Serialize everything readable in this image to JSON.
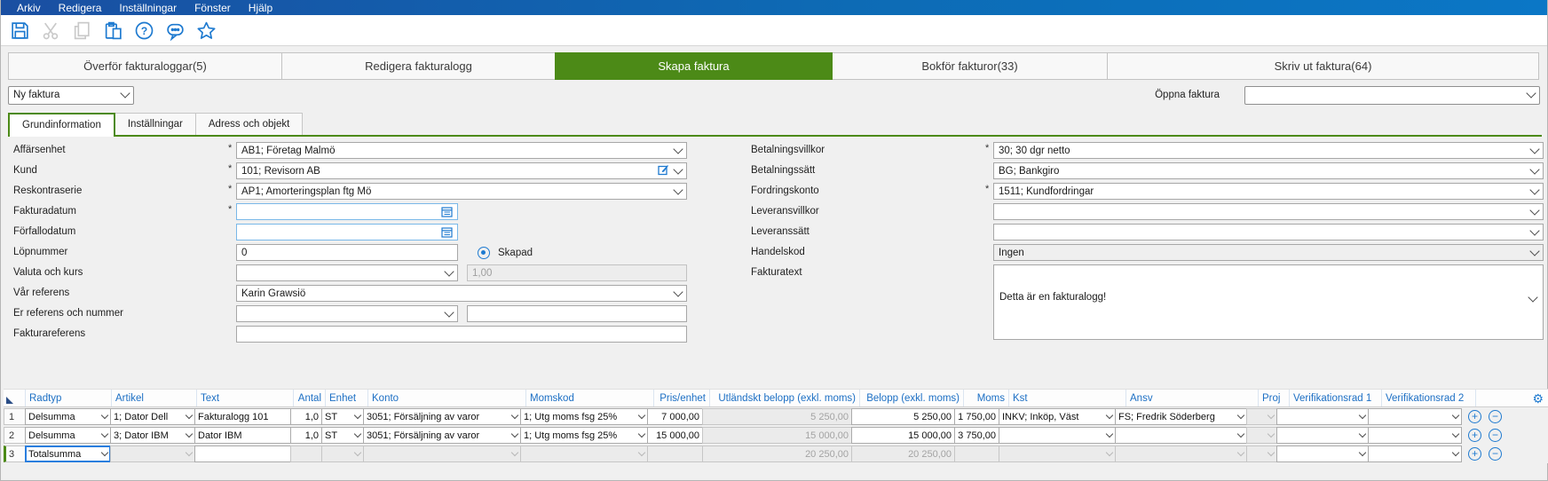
{
  "ui": {
    "required_marker": "*"
  },
  "colors": {
    "accent_green": "#4c8a17",
    "accent_blue": "#1e7ad0",
    "grid_header_text": "#1c6fc4",
    "menubar_left": "#1a4fa2",
    "menubar_right": "#0b77c6"
  },
  "menu": {
    "items": [
      "Arkiv",
      "Redigera",
      "Inställningar",
      "Fönster",
      "Hjälp"
    ]
  },
  "toolbar": {
    "icons": [
      "save-icon",
      "cut-icon",
      "copy-icon",
      "paste-icon",
      "help-icon",
      "comment-icon",
      "favorite-star-icon"
    ]
  },
  "main_tabs": [
    {
      "label": "Överför fakturaloggar(5)",
      "active": false
    },
    {
      "label": "Redigera fakturalogg",
      "active": false
    },
    {
      "label": "Skapa faktura",
      "active": true
    },
    {
      "label": "Bokför fakturor(33)",
      "active": false
    },
    {
      "label": "Skriv ut faktura(64)",
      "active": false
    }
  ],
  "invoice_bar": {
    "new_invoice_value": "Ny faktura",
    "open_invoice_label": "Öppna faktura",
    "open_invoice_value": ""
  },
  "sub_tabs": [
    {
      "label": "Grundinformation",
      "active": true
    },
    {
      "label": "Inställningar",
      "active": false
    },
    {
      "label": "Adress och objekt",
      "active": false
    }
  ],
  "form": {
    "affarsenhet": {
      "label": "Affärsenhet",
      "value": "AB1; Företag Malmö",
      "required": true
    },
    "kund": {
      "label": "Kund",
      "value": "101; Revisorn AB",
      "required": true
    },
    "reskontraserie": {
      "label": "Reskontraserie",
      "value": "AP1; Amorteringsplan ftg Mö",
      "required": true
    },
    "fakturadatum": {
      "label": "Fakturadatum",
      "value": "",
      "required": true
    },
    "forfallodatum": {
      "label": "Förfallodatum",
      "value": "",
      "required": false
    },
    "lopnummer": {
      "label": "Löpnummer",
      "value": "0",
      "status_label": "Skapad"
    },
    "valuta": {
      "label": "Valuta och kurs",
      "value": "",
      "kurs": "1,00"
    },
    "var_referens": {
      "label": "Vår referens",
      "value": "Karin Grawsiö"
    },
    "er_referens": {
      "label": "Er referens och nummer",
      "value": "",
      "number": ""
    },
    "fakturareferens": {
      "label": "Fakturareferens",
      "value": ""
    },
    "betalningsvillkor": {
      "label": "Betalningsvillkor",
      "value": "30; 30 dgr netto",
      "required": true
    },
    "betalningssatt": {
      "label": "Betalningssätt",
      "value": "BG; Bankgiro"
    },
    "fordringskonto": {
      "label": "Fordringskonto",
      "value": "1511; Kundfordringar",
      "required": true
    },
    "leveransvillkor": {
      "label": "Leveransvillkor",
      "value": ""
    },
    "leveranssatt": {
      "label": "Leveranssätt",
      "value": ""
    },
    "handelskod": {
      "label": "Handelskod",
      "value": "Ingen"
    },
    "fakturatext": {
      "label": "Fakturatext",
      "value": "Detta är en fakturalogg!"
    }
  },
  "grid": {
    "headers": [
      "Radtyp",
      "Artikel",
      "Text",
      "Antal",
      "Enhet",
      "Konto",
      "Momskod",
      "Pris/enhet",
      "Utländskt belopp (exkl. moms)",
      "Belopp (exkl. moms)",
      "Moms",
      "Kst",
      "Ansv",
      "Proj",
      "Verifikationsrad 1",
      "Verifikationsrad 2"
    ],
    "icons": {
      "add": "plus-circle-icon",
      "remove": "minus-circle-icon",
      "settings": "gear-icon"
    },
    "rows": [
      {
        "num": "1",
        "radtyp": "Delsumma",
        "artikel": "1; Dator Dell",
        "text": "Fakturalogg 101",
        "antal": "1,0",
        "enhet": "ST",
        "konto": "3051; Försäljning av varor",
        "momskod": "1; Utg moms fsg 25%",
        "pris": "7 000,00",
        "utl_belopp": "5 250,00",
        "belopp": "5 250,00",
        "moms": "1 750,00",
        "kst": "INKV; Inköp, Väst",
        "ansv": "FS; Fredrik Söderberg",
        "proj": "",
        "ver1": "",
        "ver2": ""
      },
      {
        "num": "2",
        "radtyp": "Delsumma",
        "artikel": "3; Dator IBM",
        "text": "Dator IBM",
        "antal": "1,0",
        "enhet": "ST",
        "konto": "3051; Försäljning av varor",
        "momskod": "1; Utg moms fsg 25%",
        "pris": "15 000,00",
        "utl_belopp": "15 000,00",
        "belopp": "15 000,00",
        "moms": "3 750,00",
        "kst": "",
        "ansv": "",
        "proj": "",
        "ver1": "",
        "ver2": ""
      },
      {
        "num": "3",
        "radtyp": "Totalsumma",
        "artikel": "",
        "text": "",
        "antal": "",
        "enhet": "",
        "konto": "",
        "momskod": "",
        "pris": "",
        "utl_belopp": "20 250,00",
        "belopp": "20 250,00",
        "moms": "",
        "kst": "",
        "ansv": "",
        "proj": "",
        "ver1": "",
        "ver2": ""
      }
    ]
  }
}
